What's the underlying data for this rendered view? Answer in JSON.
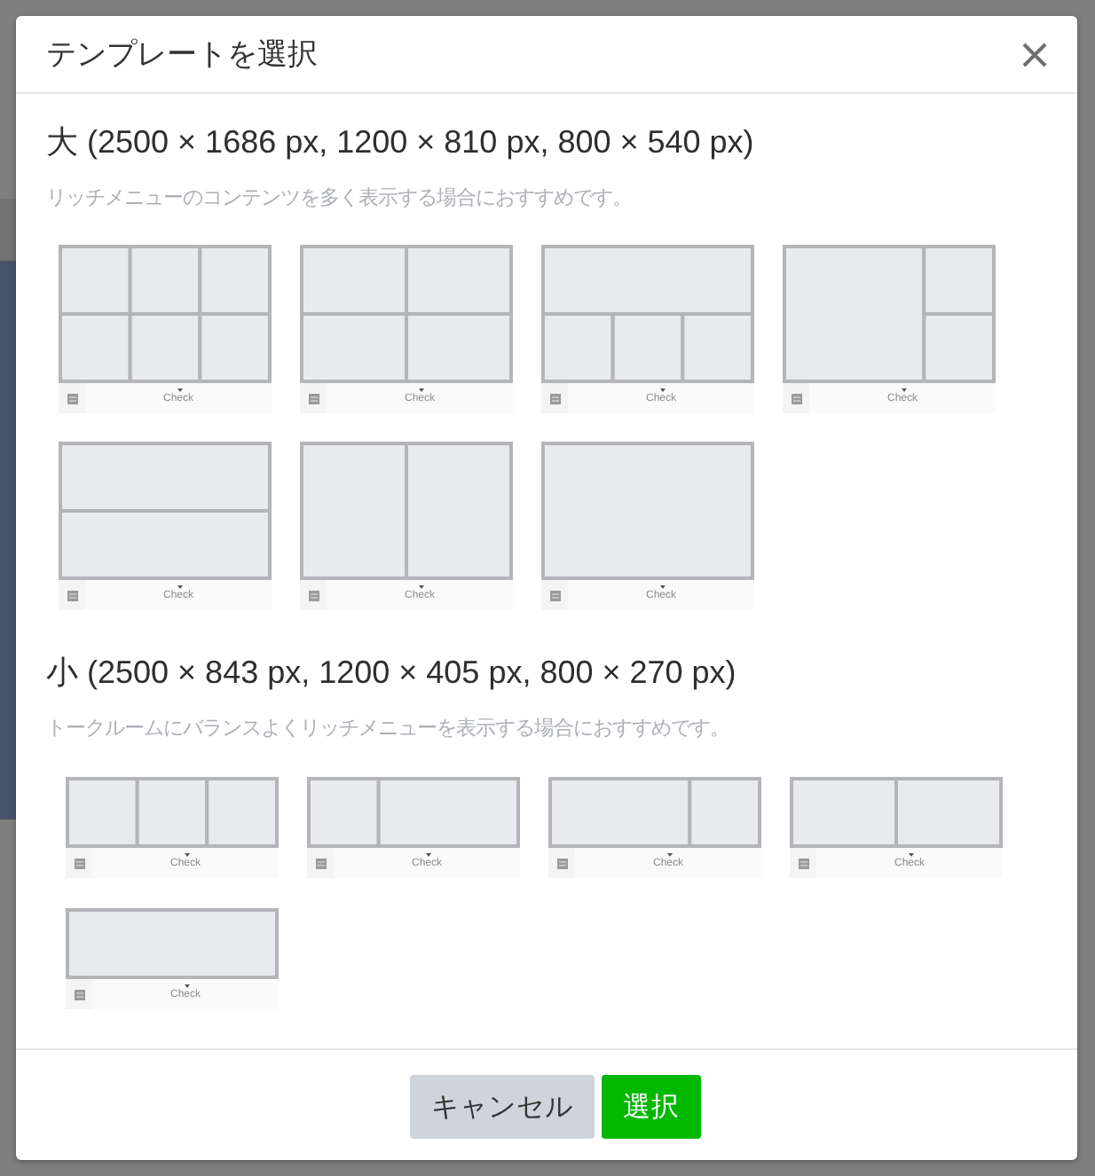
{
  "dialog": {
    "title": "テンプレートを選択"
  },
  "sections": [
    {
      "kind": "large",
      "heading": "大 (2500 × 1686 px, 1200 × 810 px, 800 × 540 px)",
      "description": "リッチメニューのコンテンツを多く表示する場合におすすめです。",
      "templates": [
        {
          "kind": "sixgrid",
          "label": "Check",
          "selected": false
        },
        {
          "kind": "quad",
          "label": "Check",
          "selected": false
        },
        {
          "kind": "topthree",
          "label": "Check",
          "selected": false
        },
        {
          "kind": "leftbig",
          "label": "Check",
          "selected": false
        },
        {
          "kind": "rows",
          "label": "Check",
          "selected": false
        },
        {
          "kind": "columns",
          "label": "Check",
          "selected": false
        },
        {
          "kind": "single",
          "label": "Check",
          "selected": false
        }
      ]
    },
    {
      "kind": "small",
      "heading": "小 (2500 × 843 px, 1200 × 405 px, 800 × 270 px)",
      "description": "トークルームにバランスよくリッチメニューを表示する場合におすすめです。",
      "templates": [
        {
          "kind": "thirds",
          "label": "Check",
          "selected": false
        },
        {
          "kind": "leftnarrow",
          "label": "Check",
          "selected": false
        },
        {
          "kind": "rightnarrow",
          "label": "Check",
          "selected": false
        },
        {
          "kind": "columns",
          "label": "Check",
          "selected": false
        },
        {
          "kind": "single",
          "label": "Check",
          "selected": false
        }
      ]
    }
  ],
  "buttons": [
    {
      "kind": "secondary",
      "label": "キャンセル"
    },
    {
      "kind": "primary",
      "label": "選択"
    }
  ]
}
